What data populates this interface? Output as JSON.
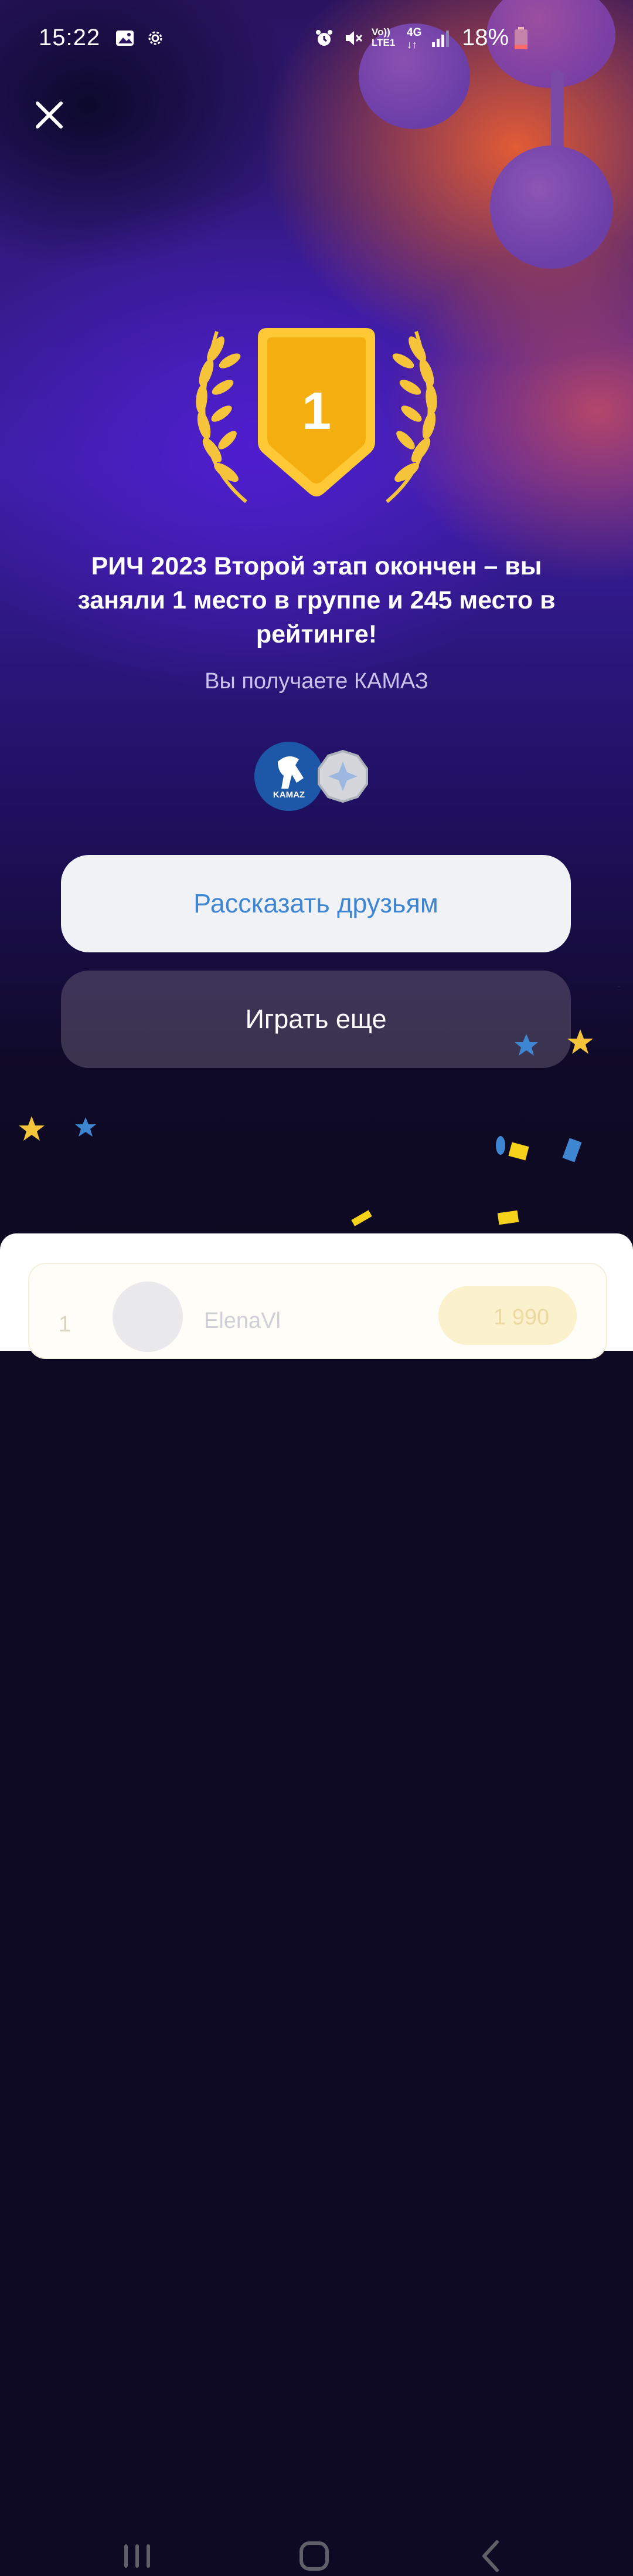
{
  "status_bar": {
    "time": "15:22",
    "network_top": "Vo))",
    "network_bottom": "LTE1",
    "net_type": "4G",
    "battery": "18%",
    "icons": [
      "gallery-icon",
      "settings-gear-icon",
      "alarm-icon",
      "mute-icon",
      "signal-icon",
      "battery-icon"
    ]
  },
  "badge": {
    "place": "1"
  },
  "result": {
    "title": "РИЧ 2023 Второй этап окончен – вы заняли 1 место в группе и 245 место в рейтинге!",
    "subtitle": "Вы получаете КАМАЗ",
    "award_logo_text": "KAMAZ"
  },
  "buttons": {
    "share": "Рассказать друзьям",
    "play_again": "Играть еще"
  },
  "leaderboard_peek": {
    "rank": "1",
    "username": "ElenaVl",
    "score": "1 990"
  },
  "colors": {
    "accent_blue": "#3f86d2",
    "gold": "#f6b21b",
    "purple": "#3b1fa0",
    "orange": "#eb5f32"
  }
}
